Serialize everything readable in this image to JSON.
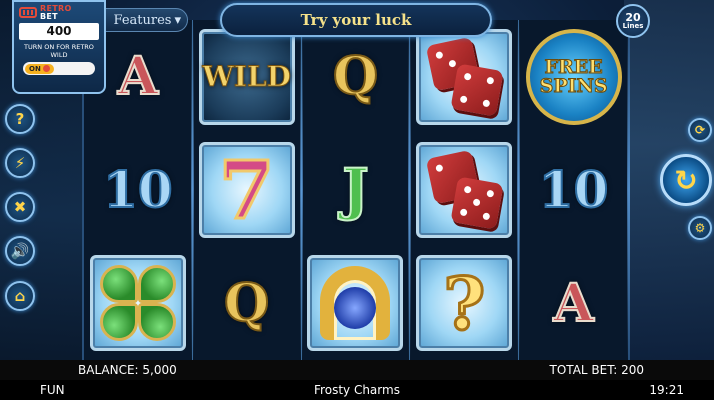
{
  "banner": {
    "message": "Try your luck"
  },
  "features_tab": {
    "label": "Features",
    "chevron": "chevron-down-icon"
  },
  "lines": {
    "count": "20",
    "label": "Lines"
  },
  "retro_bet": {
    "title_line1": "RETRO",
    "title_line2": "BET",
    "value": "400",
    "note": "TURN ON FOR RETRO WILD",
    "toggle_label": "ON"
  },
  "side_buttons": [
    {
      "name": "help",
      "icon": "question-icon",
      "glyph": "?"
    },
    {
      "name": "paytable",
      "icon": "lightning-icon",
      "glyph": "⚡"
    },
    {
      "name": "settings",
      "icon": "wrench-icon",
      "glyph": "✖"
    },
    {
      "name": "sound",
      "icon": "speaker-icon",
      "glyph": "🔊"
    },
    {
      "name": "home",
      "icon": "home-icon",
      "glyph": "⌂"
    }
  ],
  "reels": [
    [
      "A",
      "10",
      "clover"
    ],
    [
      "WILD",
      "7",
      "Q"
    ],
    [
      "Q",
      "J",
      "horseshoe"
    ],
    [
      "dice",
      "dice",
      "?"
    ],
    [
      "FREE SPINS",
      "10",
      "A"
    ]
  ],
  "symbols": {
    "wild_label": "WILD",
    "free_line1": "FREE",
    "free_line2": "SPINS",
    "seven": "7",
    "mystery": "?"
  },
  "footer": {
    "balance": "BALANCE: 5,000",
    "total_bet": "TOTAL BET: 200"
  },
  "status": {
    "mode": "FUN",
    "game_name": "Frosty Charms",
    "clock": "19:21"
  },
  "colors": {
    "accent": "#8fc3ee",
    "gold": "#f6e28a",
    "retro_red": "#e34b3a"
  }
}
